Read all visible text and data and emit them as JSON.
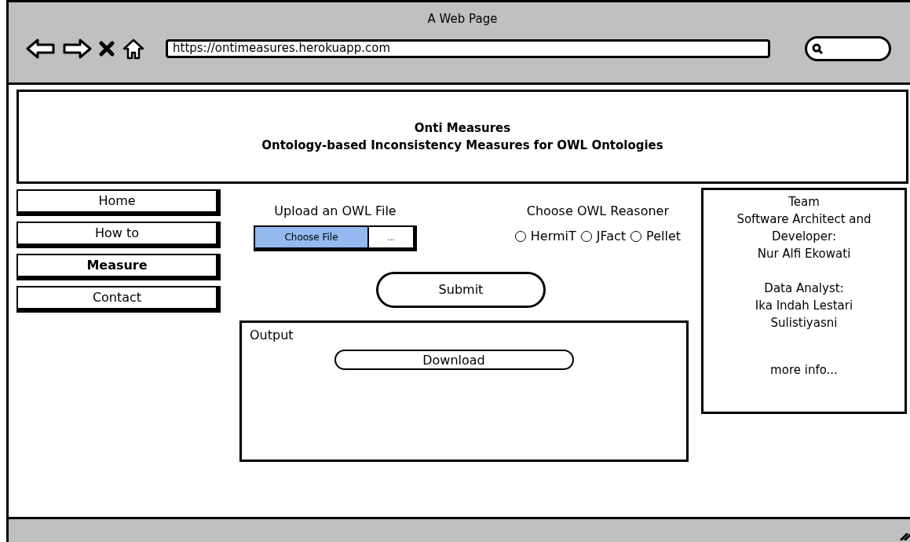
{
  "window": {
    "title": "A Web Page"
  },
  "browser": {
    "url": "https://ontimeasures.herokuapp.com"
  },
  "header": {
    "title": "Onti Measures",
    "subtitle": "Ontology-based Inconsistency Measures for OWL Ontologies"
  },
  "nav": [
    {
      "label": "Home",
      "selected": false
    },
    {
      "label": "How to",
      "selected": false
    },
    {
      "label": "Measure",
      "selected": true
    },
    {
      "label": "Contact",
      "selected": false
    }
  ],
  "upload": {
    "label": "Upload an OWL File",
    "button": "Choose File",
    "file_name": "..."
  },
  "reasoner": {
    "label": "Choose OWL Reasoner",
    "options": [
      {
        "label": "HermiT",
        "selected": false
      },
      {
        "label": "JFact",
        "selected": false
      },
      {
        "label": "Pellet",
        "selected": false
      }
    ]
  },
  "submit": "Submit",
  "output": {
    "label": "Output",
    "download": "Download"
  },
  "team": {
    "groups": [
      [
        "Team",
        "Software Architect and Developer:",
        "Nur Alfi Ekowati"
      ],
      [
        "Data Analyst:",
        "Ika Indah Lestari Sulistiyasni"
      ]
    ],
    "link": "more info..."
  }
}
